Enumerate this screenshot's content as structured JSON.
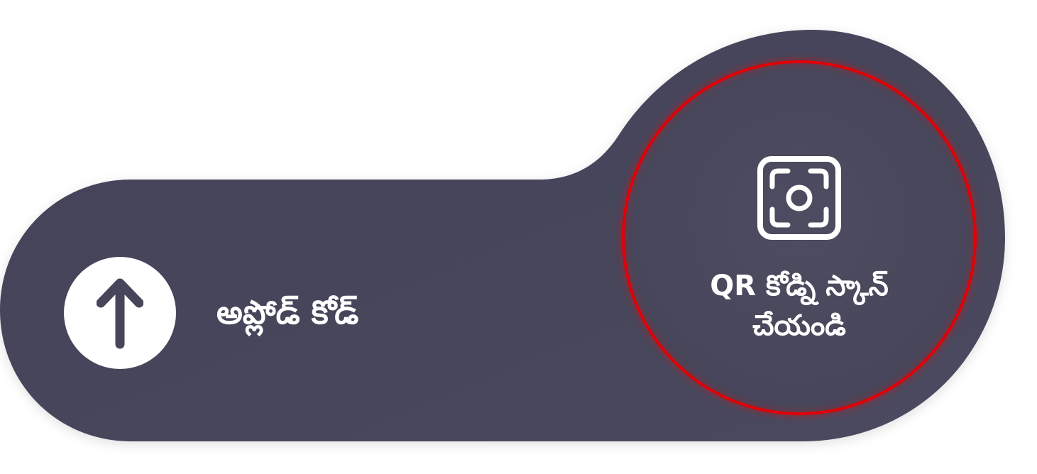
{
  "colors": {
    "panel": "#46455a",
    "panel_light": "#4b4a60",
    "ring": "#e00006",
    "text": "#ffffff",
    "background": "#ffffff"
  },
  "upload": {
    "icon": "arrow-up-icon",
    "label": "అప్లోడ్ కోడ్"
  },
  "scan": {
    "icon": "qr-scan-icon",
    "label_line1": "QR కోడ్ని స్కాన్",
    "label_line2": "చేయండి"
  }
}
